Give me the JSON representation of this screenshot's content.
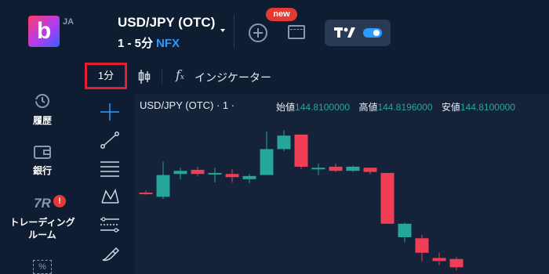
{
  "header": {
    "logo_letter": "b",
    "language": "JA",
    "asset_name": "USD/JPY (OTC)",
    "expiry": "1 - 5分",
    "asset_tag": "NFX",
    "new_badge": "new"
  },
  "sidebar": {
    "items": [
      {
        "label": "履歴",
        "icon": "history-icon"
      },
      {
        "label": "銀行",
        "icon": "wallet-icon"
      },
      {
        "label": "トレーディング\nルーム",
        "icon": "trading-room-icon",
        "icon_text": "7R",
        "alert": "!"
      },
      {
        "label": "",
        "icon": "percent-icon",
        "icon_text": "%"
      }
    ]
  },
  "chart_toolbar": {
    "timeframe": "1分",
    "indicators_label": "インジケーター"
  },
  "chart": {
    "legend": "USD/JPY (OTC) · 1 ·",
    "ohlc": [
      {
        "label": "始値",
        "value": "144.8100000"
      },
      {
        "label": "高値",
        "value": "144.8196000"
      },
      {
        "label": "安値",
        "value": "144.8100000"
      }
    ],
    "colors": {
      "up": "#26a69a",
      "down": "#ef3e55",
      "background": "#14233a"
    }
  },
  "chart_data": {
    "type": "candlestick",
    "title": "USD/JPY (OTC) · 1 ·",
    "candles": [
      {
        "o": 144.813,
        "h": 144.8132,
        "l": 144.8128,
        "c": 144.8129
      },
      {
        "o": 144.8126,
        "h": 144.816,
        "l": 144.8124,
        "c": 144.8147
      },
      {
        "o": 144.8148,
        "h": 144.8154,
        "l": 144.8143,
        "c": 144.8151
      },
      {
        "o": 144.8152,
        "h": 144.8155,
        "l": 144.8146,
        "c": 144.8148
      },
      {
        "o": 144.8149,
        "h": 144.8154,
        "l": 144.814,
        "c": 144.8149
      },
      {
        "o": 144.8148,
        "h": 144.8153,
        "l": 144.814,
        "c": 144.8145
      },
      {
        "o": 144.8143,
        "h": 144.8148,
        "l": 144.8139,
        "c": 144.8146
      },
      {
        "o": 144.8147,
        "h": 144.8189,
        "l": 144.8147,
        "c": 144.8172
      },
      {
        "o": 144.8172,
        "h": 144.819,
        "l": 144.817,
        "c": 144.8185
      },
      {
        "o": 144.8186,
        "h": 144.8186,
        "l": 144.8153,
        "c": 144.8155
      },
      {
        "o": 144.8154,
        "h": 144.8158,
        "l": 144.8147,
        "c": 144.8154
      },
      {
        "o": 144.8155,
        "h": 144.8158,
        "l": 144.815,
        "c": 144.8151
      },
      {
        "o": 144.8151,
        "h": 144.8156,
        "l": 144.815,
        "c": 144.8155
      },
      {
        "o": 144.8154,
        "h": 144.8154,
        "l": 144.8148,
        "c": 144.815
      },
      {
        "o": 144.8149,
        "h": 144.8149,
        "l": 144.81,
        "c": 144.81
      },
      {
        "o": 144.8087,
        "h": 144.8101,
        "l": 144.8082,
        "c": 144.81
      },
      {
        "o": 144.8086,
        "h": 144.8089,
        "l": 144.8064,
        "c": 144.8072
      },
      {
        "o": 144.8067,
        "h": 144.8072,
        "l": 144.806,
        "c": 144.8064
      },
      {
        "o": 144.8066,
        "h": 144.8068,
        "l": 144.8055,
        "c": 144.8058
      }
    ],
    "ylim": [
      144.805,
      144.8195
    ]
  }
}
